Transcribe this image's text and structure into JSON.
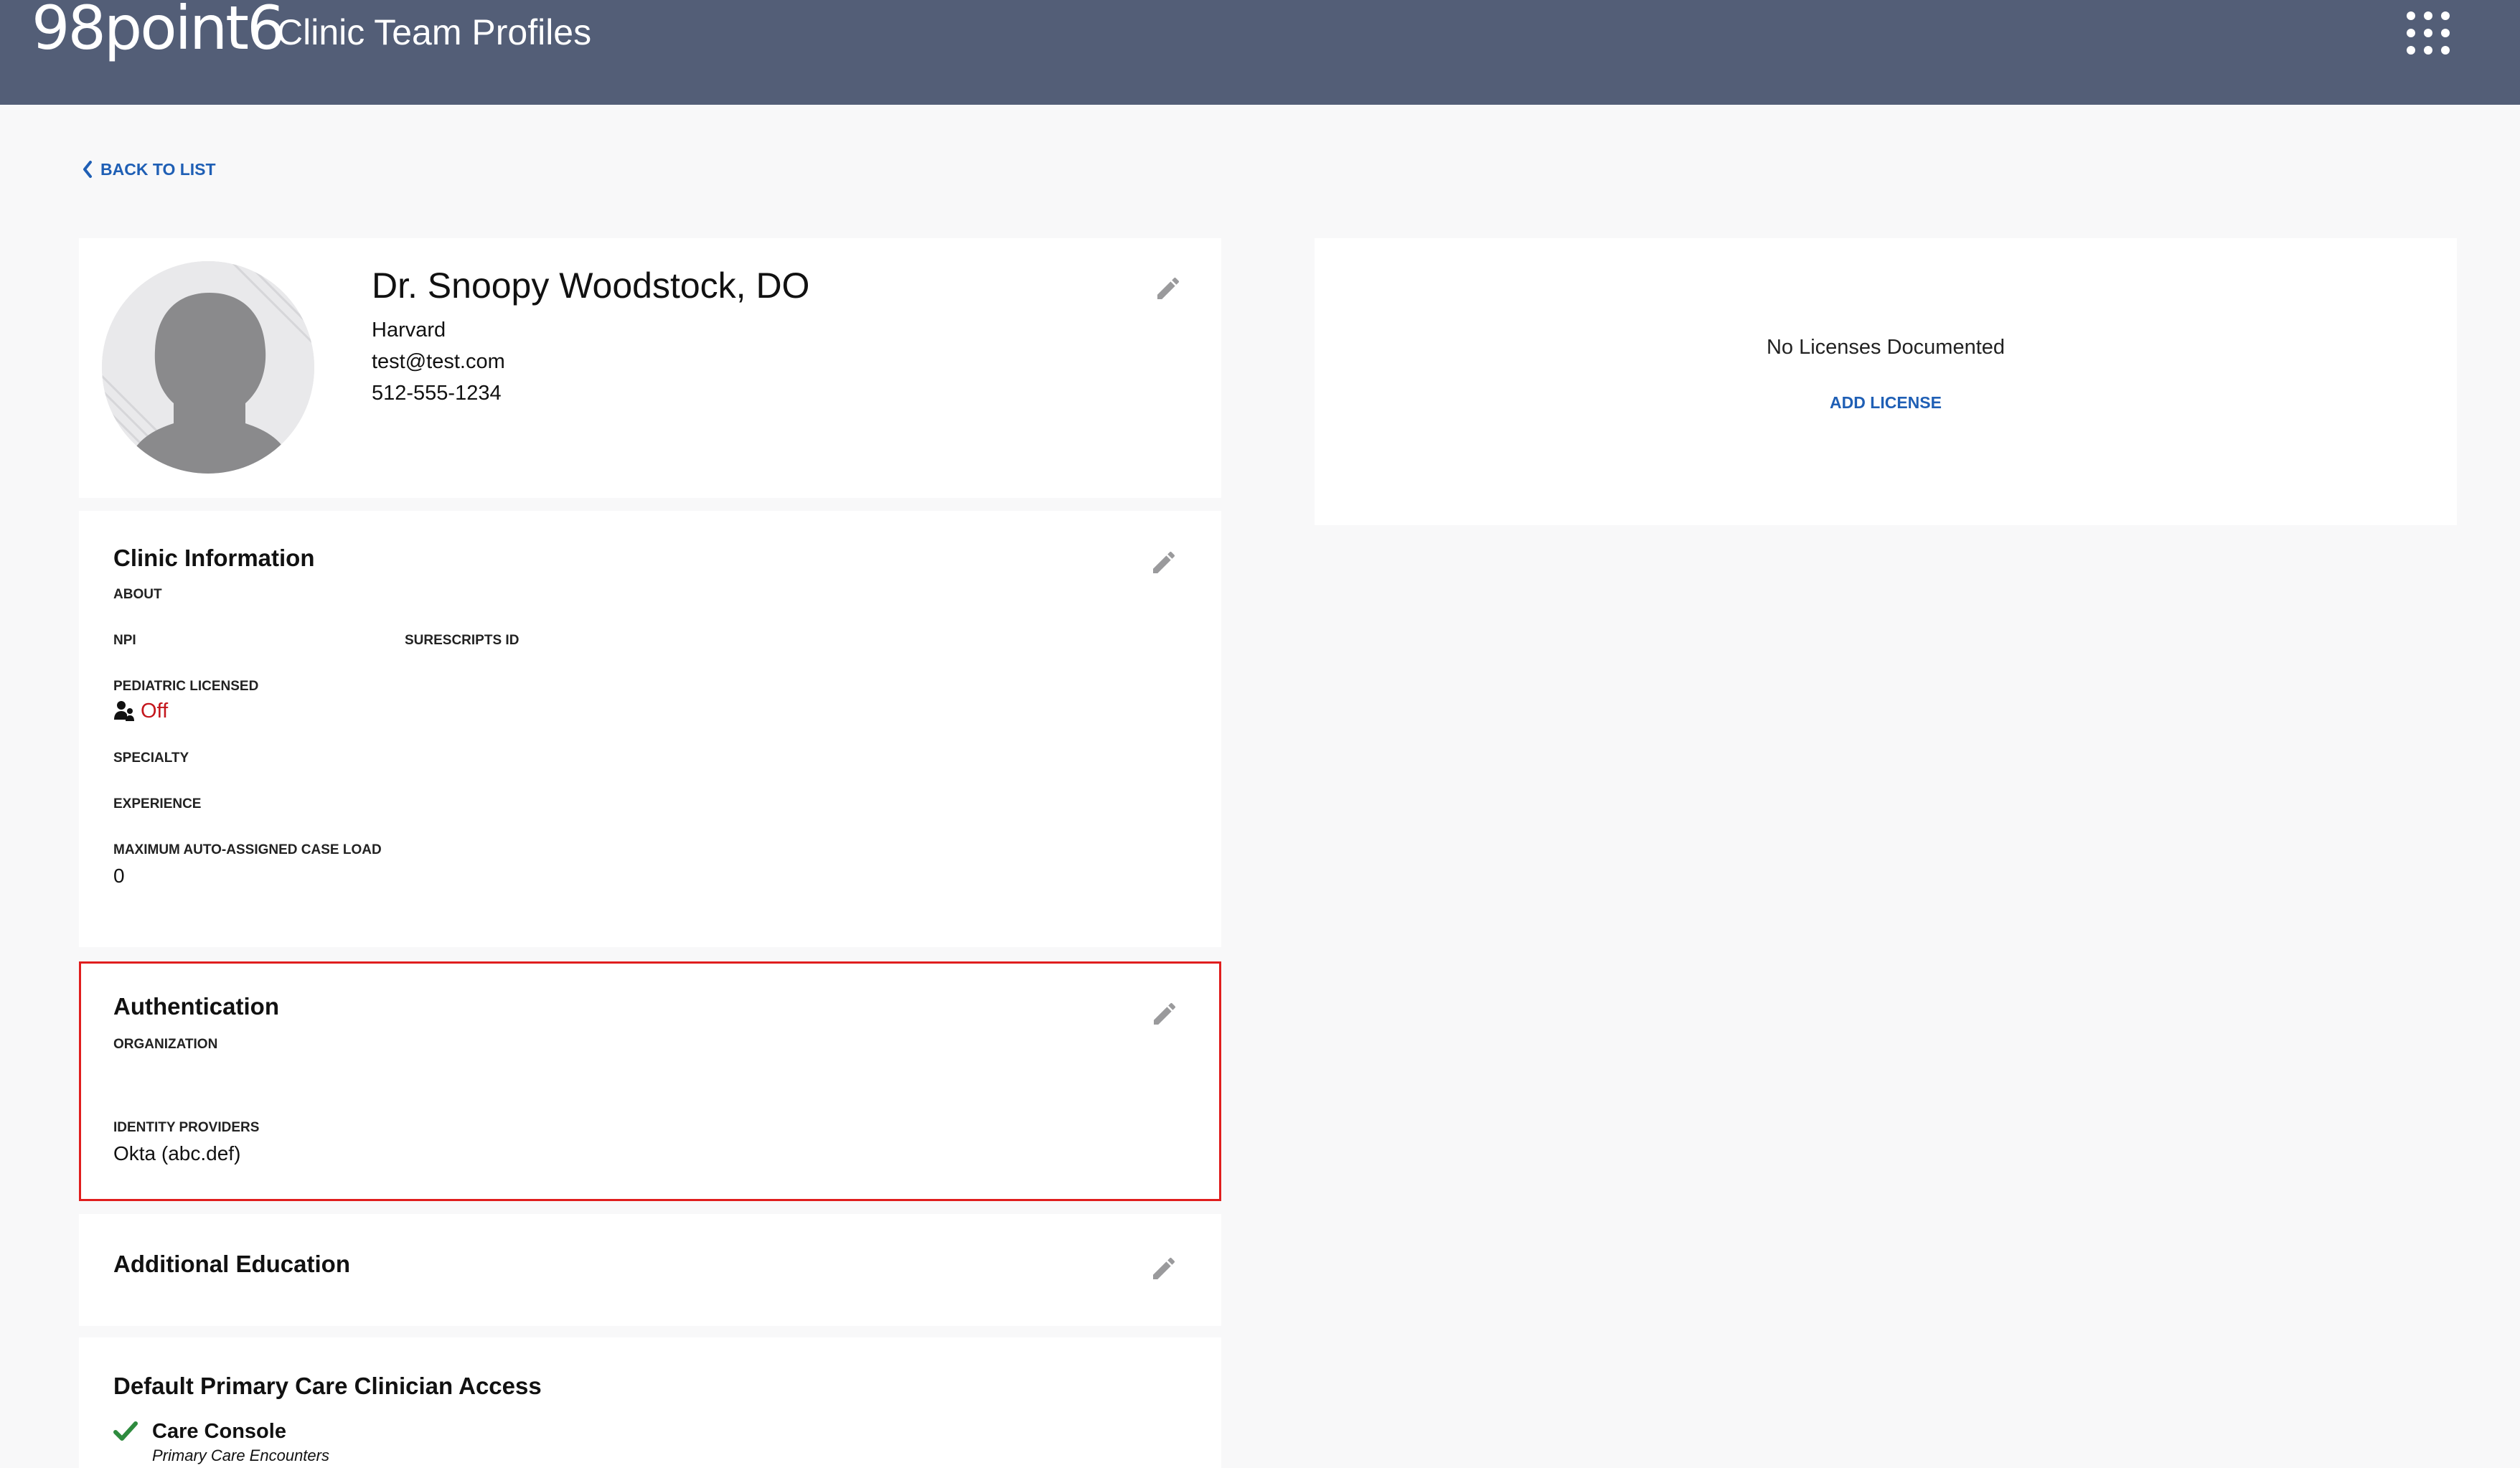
{
  "header": {
    "logo_text": "98point6",
    "title": "Clinic Team Profiles",
    "apps_icon": "grid-menu-icon"
  },
  "nav": {
    "back_label": "BACK TO LIST"
  },
  "profile": {
    "name": "Dr. Snoopy Woodstock, DO",
    "school": "Harvard",
    "email": "test@test.com",
    "phone": "512-555-1234"
  },
  "clinic_info": {
    "title": "Clinic Information",
    "about_label": "ABOUT",
    "npi_label": "NPI",
    "surescripts_label": "SURESCRIPTS ID",
    "pediatric_label": "PEDIATRIC LICENSED",
    "pediatric_value": "Off",
    "specialty_label": "SPECIALTY",
    "experience_label": "EXPERIENCE",
    "caseload_label": "MAXIMUM AUTO-ASSIGNED CASE LOAD",
    "caseload_value": "0"
  },
  "authentication": {
    "title": "Authentication",
    "organization_label": "ORGANIZATION",
    "idp_label": "IDENTITY PROVIDERS",
    "idp_value": "Okta (abc.def)"
  },
  "additional_education": {
    "title": "Additional Education"
  },
  "default_access": {
    "title": "Default Primary Care Clinician Access",
    "item_title": "Care Console",
    "item_subtitle": "Primary Care Encounters"
  },
  "licenses": {
    "empty_text": "No Licenses Documented",
    "add_label": "ADD LICENSE"
  },
  "colors": {
    "header_bg": "#535e77",
    "link": "#1f5fb5",
    "off_red": "#c4161c",
    "check_green": "#2e8b3e",
    "highlight_border": "#e01e1e"
  }
}
